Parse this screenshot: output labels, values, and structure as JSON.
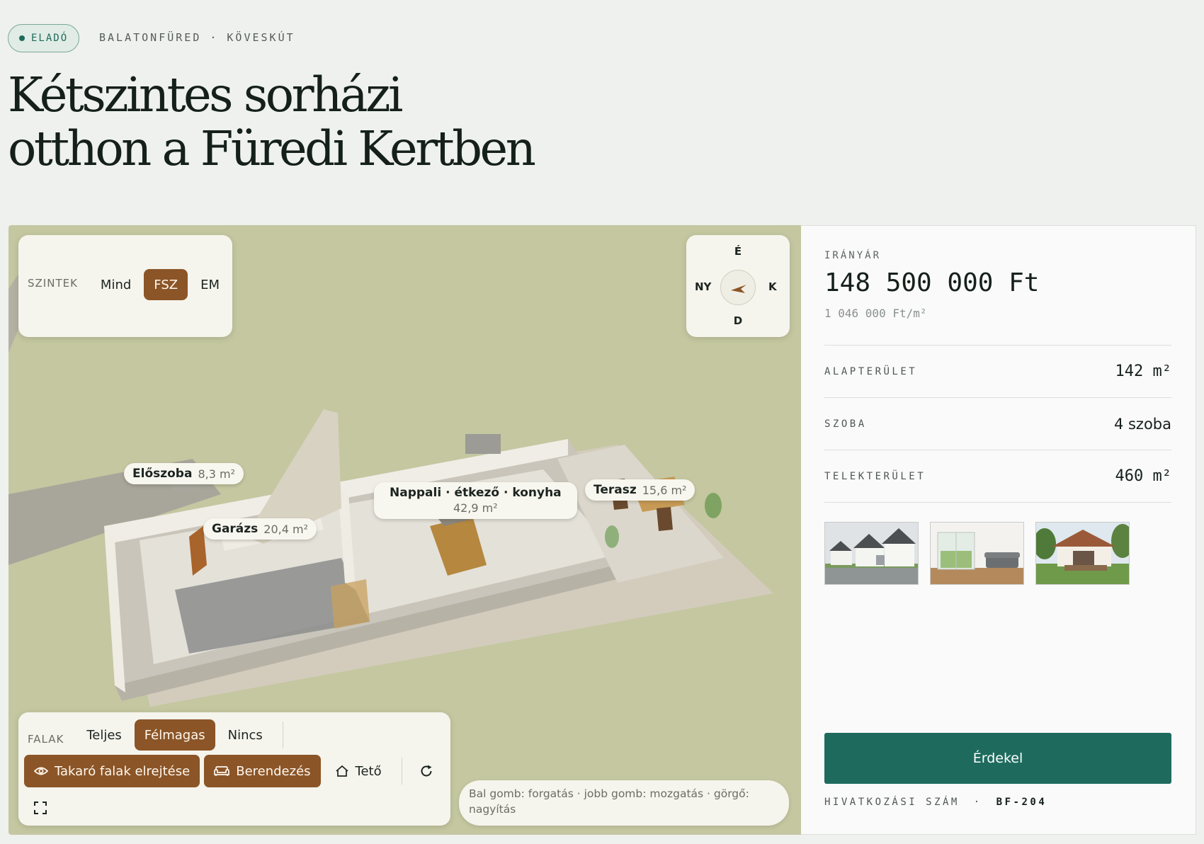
{
  "header": {
    "status": "ELADÓ",
    "breadcrumb": [
      "BALATONFÜRED",
      "KÖVESKÚT"
    ],
    "breadcrumb_sep": "·",
    "title_line1": "Kétszintes sorházi",
    "title_line2": "otthon a Füredi Kertben"
  },
  "viewer": {
    "levels": {
      "label": "SZINTEK",
      "options": [
        "Mind",
        "FSZ",
        "EM"
      ],
      "selected": "FSZ"
    },
    "compass": {
      "north": "É",
      "south": "D",
      "west": "NY",
      "east": "K"
    },
    "walls": {
      "label": "FALAK",
      "options": [
        "Teljes",
        "Félmagas",
        "Nincs"
      ],
      "selected": "Félmagas"
    },
    "toggles": {
      "hide_walls": "Takaró falak elrejtése",
      "furniture": "Berendezés",
      "roof": "Tető"
    },
    "hint": "Bal gomb: forgatás · jobb gomb: mozgatás · görgő: nagyítás",
    "rooms": [
      {
        "name": "Előszoba",
        "area": "8,3 m²"
      },
      {
        "name": "Garázs",
        "area": "20,4 m²"
      },
      {
        "name": "Nappali · étkező · konyha",
        "area": "42,9 m²"
      },
      {
        "name": "Terasz",
        "area": "15,6 m²"
      }
    ],
    "icons": [
      "eye-icon",
      "sofa-icon",
      "house-icon",
      "rotate-icon",
      "fullscreen-icon",
      "compass-needle-icon"
    ]
  },
  "sidebar": {
    "price_label": "IRÁNYÁR",
    "price": "148 500 000 Ft",
    "price_per_sqm": "1 046 000 Ft/m²",
    "specs": [
      {
        "key": "ALAPTERÜLET",
        "value": "142 m²"
      },
      {
        "key": "SZOBA",
        "value": "4 szoba"
      },
      {
        "key": "TELEKTERÜLET",
        "value": "460 m²"
      }
    ],
    "thumbnails": [
      "exterior-street-photo",
      "living-room-photo",
      "garden-terrace-photo"
    ],
    "cta": "Érdekel",
    "ref_label": "HIVATKOZÁSI SZÁM",
    "ref_sep": "·",
    "ref_value": "BF-204"
  },
  "colors": {
    "accent_brown": "#8b5527",
    "cta_green": "#1e6b5e",
    "lawn": "#c4c7a0",
    "status_green": "#1e6b5a"
  }
}
